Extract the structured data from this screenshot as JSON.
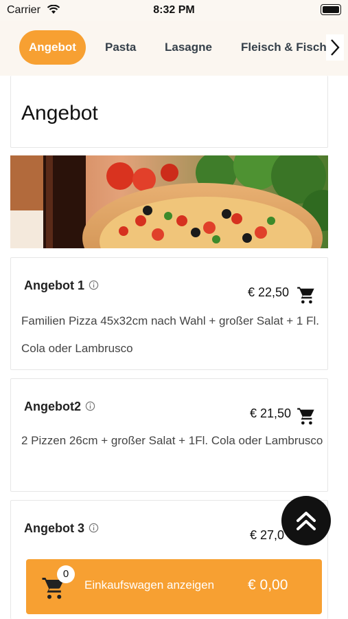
{
  "status_bar": {
    "carrier": "Carrier",
    "time": "8:32 PM"
  },
  "categories": [
    {
      "label": "Angebot",
      "active": true
    },
    {
      "label": "Pasta",
      "active": false
    },
    {
      "label": "Lasagne",
      "active": false
    },
    {
      "label": "Fleisch & Fisch",
      "active": false
    }
  ],
  "page": {
    "title": "Angebot"
  },
  "offers": [
    {
      "name": "Angebot 1",
      "price": "€ 22,50",
      "description": "Familien Pizza 45x32cm nach Wahl + großer Salat + 1 Fl. Cola oder Lambrusco"
    },
    {
      "name": "Angebot2",
      "price": "€ 21,50",
      "description": "2 Pizzen 26cm + großer Salat + 1Fl. Cola oder Lambrusco"
    },
    {
      "name": "Angebot 3",
      "price": "€ 27,0",
      "description": ""
    }
  ],
  "cart": {
    "count": "0",
    "label": "Einkaufswagen anzeigen",
    "total": "€ 0,00"
  },
  "colors": {
    "accent": "#f7a032",
    "header_bg": "#fbf6f0",
    "fab": "#111111"
  },
  "icons": {
    "wifi": "wifi-icon",
    "battery": "battery-icon",
    "chevron": "chevron-right-icon",
    "info": "info-icon",
    "cart": "shopping-cart-icon",
    "scroll_top": "double-chevron-up-icon"
  }
}
